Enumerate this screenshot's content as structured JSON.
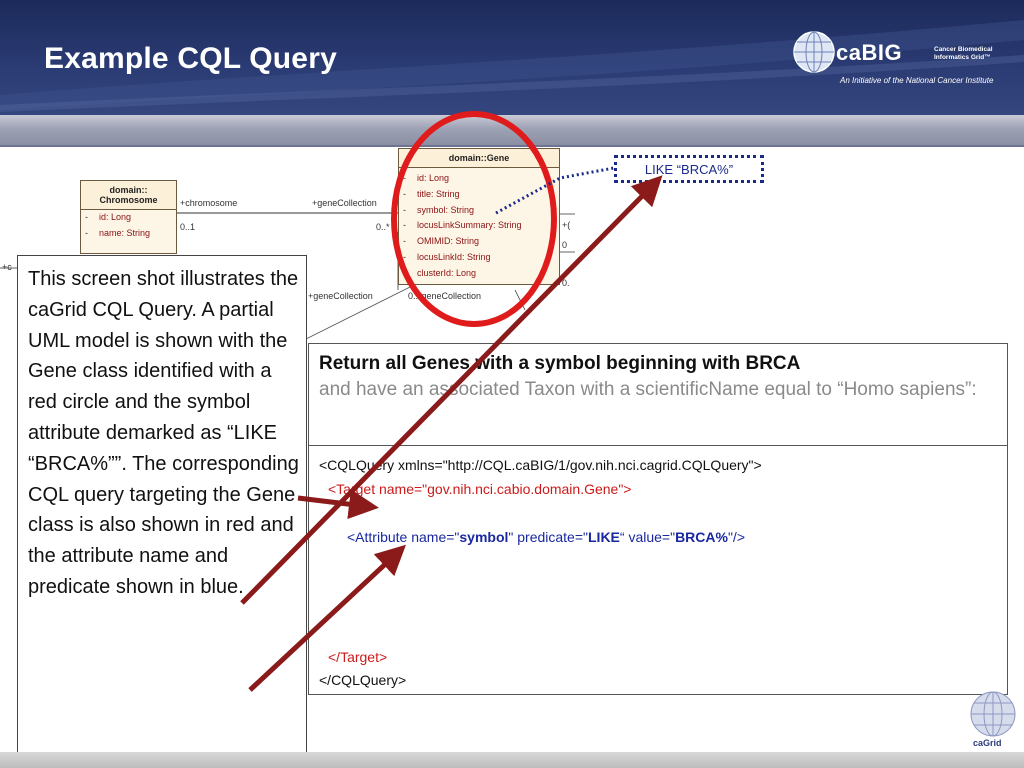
{
  "slide": {
    "title": "Example CQL Query"
  },
  "logo": {
    "name": "caBIG",
    "tagline_line1": "Cancer Biomedical",
    "tagline_line2": "Informatics Grid™",
    "initiative": "An Initiative of the National Cancer Institute"
  },
  "uml": {
    "gene": {
      "header": "domain::Gene",
      "attributes": [
        "id:  Long",
        "title:  String",
        "symbol:  String",
        "locusLinkSummary:  String",
        "OMIMID:  String",
        "locusLinkId:  String",
        "clusterId:  Long"
      ]
    },
    "chromosome": {
      "header_line1": "domain::",
      "header_line2": "Chromosome",
      "attributes": [
        "id:  Long",
        "name:  String"
      ]
    },
    "labels": {
      "chromosome_role": "+chromosome",
      "gene_collection_top": "+geneCollection",
      "mult_0_1": "0..1",
      "mult_0_star": "0..*",
      "gene_collection_left": "+geneCollection",
      "gene_collection_bottom": "0..*geneCollection",
      "left_cut": "+c",
      "right_cut_1": "+(",
      "right_cut_2": "0",
      "right_cut_3": "0."
    }
  },
  "like_annotation": "LIKE “BRCA%”",
  "query": {
    "heading_bold": "Return all Genes with a symbol beginning with BRCA",
    "heading_gray": "and have an associated Taxon with a scientificName equal to “Homo sapiens”:",
    "line_open": "<CQLQuery xmlns=\"http://CQL.caBIG/1/gov.nih.nci.cagrid.CQLQuery\">",
    "line_target": "<Target name=\"gov.nih.nci.cabio.domain.Gene\">",
    "attr_prefix": "<Attribute name=\"",
    "attr_name": "symbol",
    "attr_mid": "\" predicate=\"",
    "attr_pred": "LIKE",
    "attr_mid2": "“ value=\"",
    "attr_value": "BRCA%",
    "attr_end": "\"/>",
    "line_target_close": "</Target>",
    "line_close": "</CQLQuery>"
  },
  "description": "This screen shot illustrates the caGrid CQL Query. A partial UML model is shown with the Gene class identified with a red circle and the symbol attribute demarked as “LIKE “BRCA%””. The corresponding CQL query targeting the Gene class is also shown in red and the attribute name and predicate shown in blue.",
  "footer_logo": "caGrid",
  "colors": {
    "header_bg": "#243366",
    "highlight_red": "#e01b1b",
    "arrow_red": "#8b1a1a",
    "query_red": "#cc1a1a",
    "query_blue": "#1a28a0"
  }
}
